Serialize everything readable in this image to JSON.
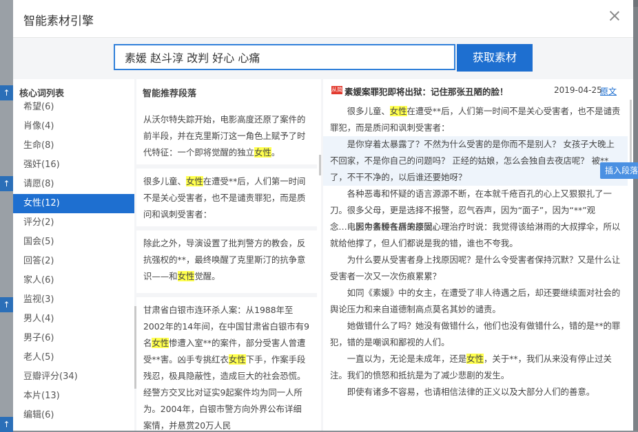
{
  "modal": {
    "title": "智能素材引擎",
    "search_value": "素媛 赵斗淳 改判 好心 心痛",
    "search_button": "获取素材"
  },
  "keywords": {
    "header": "核心词列表",
    "items": [
      "希望(6)",
      "肖像(4)",
      "生命(8)",
      "强奸(16)",
      "请愿(8)",
      "女性(12)",
      "评分(2)",
      "国会(5)",
      "回答(2)",
      "家人(6)",
      "监视(3)",
      "男人(4)",
      "男子(6)",
      "老人(5)",
      "豆瓣评分(34)",
      "本片(13)",
      "编辑(6)"
    ],
    "active_index": 5
  },
  "recommend": {
    "header": "智能推荐段落",
    "paragraphs": [
      {
        "before": "从沃尔特失踪开始，电影高度还原了案件的前半段，并在克里斯汀这一角色上赋予了时代特征：一个即将觉醒的独立",
        "hl": "女性",
        "after": "。"
      },
      {
        "before": "很多儿童、",
        "hl": "女性",
        "after": "在遭受**后，人们第一时间不是关心受害者，也不是谴责罪犯，而是质问和讽刺受害者："
      },
      {
        "before": "除此之外，导演设置了批判警方的教会，反抗强权的**，最终唤醒了克里斯汀的抗争意识——和",
        "hl": "女性",
        "after": "觉醒。"
      },
      {
        "before": "甘肃省白银市连环杀人案：从1988年至2002年的14年间，在中国甘肃省白银市有9名",
        "hl": "女性",
        "after": "惨遭入室**的案件，部分受害人曾遭受**害。凶手专挑红衣",
        "hl2": "女性",
        "after2": "下手，作案手段残忍，极具隐蔽性，造成巨大的社会恐慌。经警方交叉比对证实9起案件均为同一人所为。2004年，白银市警方向外界公布详细案情，并悬赏20万人民"
      }
    ]
  },
  "article": {
    "tag": "从简",
    "title": "素媛案罪犯即将出狱：记住那张丑陋的脸！",
    "date": "2019-04-25",
    "original_link": "原文",
    "insert_button": "插入段落",
    "paragraphs": [
      {
        "before": "很多儿童、",
        "hl": "女性",
        "after": "在遭受**后，人们第一时间不是关心受害者，也不是谴责罪犯，而是质问和讽刺受害者："
      },
      {
        "before": "是你穿着太暴露了？不然为什么受害的是你而不是别人？ 女孩子大晚上不回家，不是你自己的问题吗？ 正经的姑娘，怎么会独自去夜店呢？ 被**了，不干不净的，以后谁还要她呀？",
        "hl": "",
        "after": ""
      },
      {
        "before": "各种恶毒和怀疑的语言源源不断，在本就千疮百孔的心上又狠狠扎了一刀。",
        "hl": "",
        "after": ""
      },
      {
        "before": "很多父母，更是选择不报警，忍气吞声，因为“面子”，因为“**”观念……因为各种各样的原因。",
        "hl": "",
        "after": ""
      },
      {
        "before": "电影中素媛在后来接受心理治疗时说：我觉得该给淋雨的大叔撑伞，所以就给他撑了，但人们都说是我的错，谁也不夸我。",
        "hl": "",
        "after": ""
      },
      {
        "before": "为什么要从受害者身上找原因呢？是什么令受害者保持沉默？又是什么让受害者一次又一次伤痕累累？",
        "hl": "",
        "after": ""
      },
      {
        "before": "如同《素媛》中的女主，在遭受了非人待遇之后，却还要继续面对社会的舆论压力和来自道德制高点莫名其妙的谴责。",
        "hl": "",
        "after": ""
      },
      {
        "before": "她做错什么了吗？她没有做错什么，他们也没有做错什么，错的是**的罪犯，错的是嘲讽和鄙视的人们。",
        "hl": "",
        "after": ""
      },
      {
        "before": "一直以为，无论是未成年，还是",
        "hl": "女性",
        "after": "，关于**，我们从来没有停止过关注。我们的愤怒和抵抗是为了减少悲剧的发生。"
      },
      {
        "before": "即使有诸多不容易，也请相信法律的正义以及大部分人们的善意。",
        "hl": "",
        "after": ""
      }
    ]
  }
}
